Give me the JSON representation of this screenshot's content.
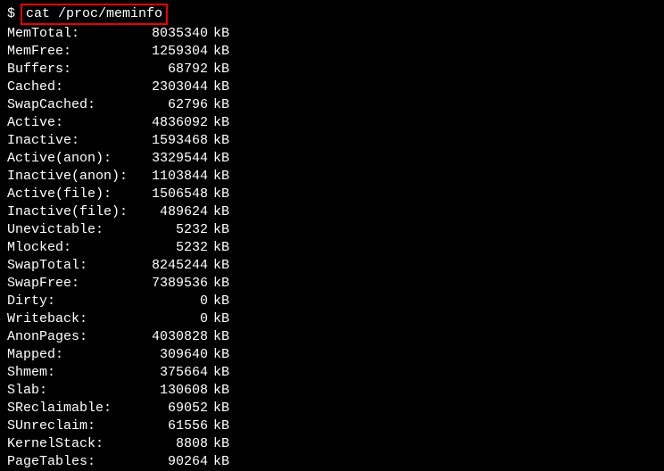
{
  "prompt": "$",
  "command": "cat /proc/meminfo",
  "unit": "kB",
  "rows": [
    {
      "label": "MemTotal:",
      "value": "8035340"
    },
    {
      "label": "MemFree:",
      "value": "1259304"
    },
    {
      "label": "Buffers:",
      "value": "68792"
    },
    {
      "label": "Cached:",
      "value": "2303044"
    },
    {
      "label": "SwapCached:",
      "value": "62796"
    },
    {
      "label": "Active:",
      "value": "4836092"
    },
    {
      "label": "Inactive:",
      "value": "1593468"
    },
    {
      "label": "Active(anon):",
      "value": "3329544"
    },
    {
      "label": "Inactive(anon):",
      "value": "1103844"
    },
    {
      "label": "Active(file):",
      "value": "1506548"
    },
    {
      "label": "Inactive(file):",
      "value": "489624"
    },
    {
      "label": "Unevictable:",
      "value": "5232"
    },
    {
      "label": "Mlocked:",
      "value": "5232"
    },
    {
      "label": "SwapTotal:",
      "value": "8245244"
    },
    {
      "label": "SwapFree:",
      "value": "7389536"
    },
    {
      "label": "Dirty:",
      "value": "0"
    },
    {
      "label": "Writeback:",
      "value": "0"
    },
    {
      "label": "AnonPages:",
      "value": "4030828"
    },
    {
      "label": "Mapped:",
      "value": "309640"
    },
    {
      "label": "Shmem:",
      "value": "375664"
    },
    {
      "label": "Slab:",
      "value": "130608"
    },
    {
      "label": "SReclaimable:",
      "value": "69052"
    },
    {
      "label": "SUnreclaim:",
      "value": "61556"
    },
    {
      "label": "KernelStack:",
      "value": "8808"
    },
    {
      "label": "PageTables:",
      "value": "90264"
    }
  ]
}
